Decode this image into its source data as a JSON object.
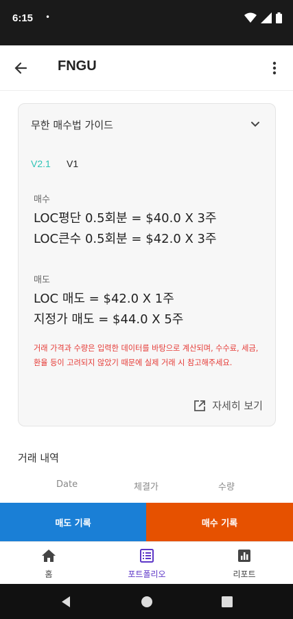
{
  "status_bar": {
    "time": "6:15",
    "dot": "•"
  },
  "app_bar": {
    "title": "FNGU"
  },
  "guide": {
    "title": "무한 매수법 가이드",
    "tab_active": "V2.1",
    "tab_inactive": "V1",
    "buy_label": "매수",
    "buy_lines": [
      "LOC평단 0.5회분 = $40.0 X 3주",
      "LOC큰수 0.5회분 = $42.0 X 3주"
    ],
    "sell_label": "매도",
    "sell_lines": [
      "LOC 매도 = $42.0 X 1주",
      "지정가 매도 = $44.0 X 5주"
    ],
    "notice": "거래 가격과 수량은 입력한 데이터를 바탕으로 계산되며, 수수료, 세금, 환율 등이 고려되지 않았기 때문에 실제 거래 시 참고해주세요.",
    "detail_link": "자세히 보기"
  },
  "history": {
    "title": "거래 내역",
    "columns": [
      "Date",
      "체결가",
      "수량"
    ]
  },
  "actions": {
    "sell": "매도 기록",
    "buy": "매수 기록"
  },
  "bottom_nav": {
    "items": [
      {
        "label": "홈",
        "icon": "home-icon"
      },
      {
        "label": "포트폴리오",
        "icon": "portfolio-icon"
      },
      {
        "label": "리포트",
        "icon": "report-icon"
      }
    ],
    "active": "포트폴리오"
  },
  "colors": {
    "accent_teal": "#2ec4b6",
    "sell_blue": "#1a7fd6",
    "buy_orange": "#e65100",
    "nav_active": "#5c35c7",
    "notice_red": "#e53935"
  }
}
